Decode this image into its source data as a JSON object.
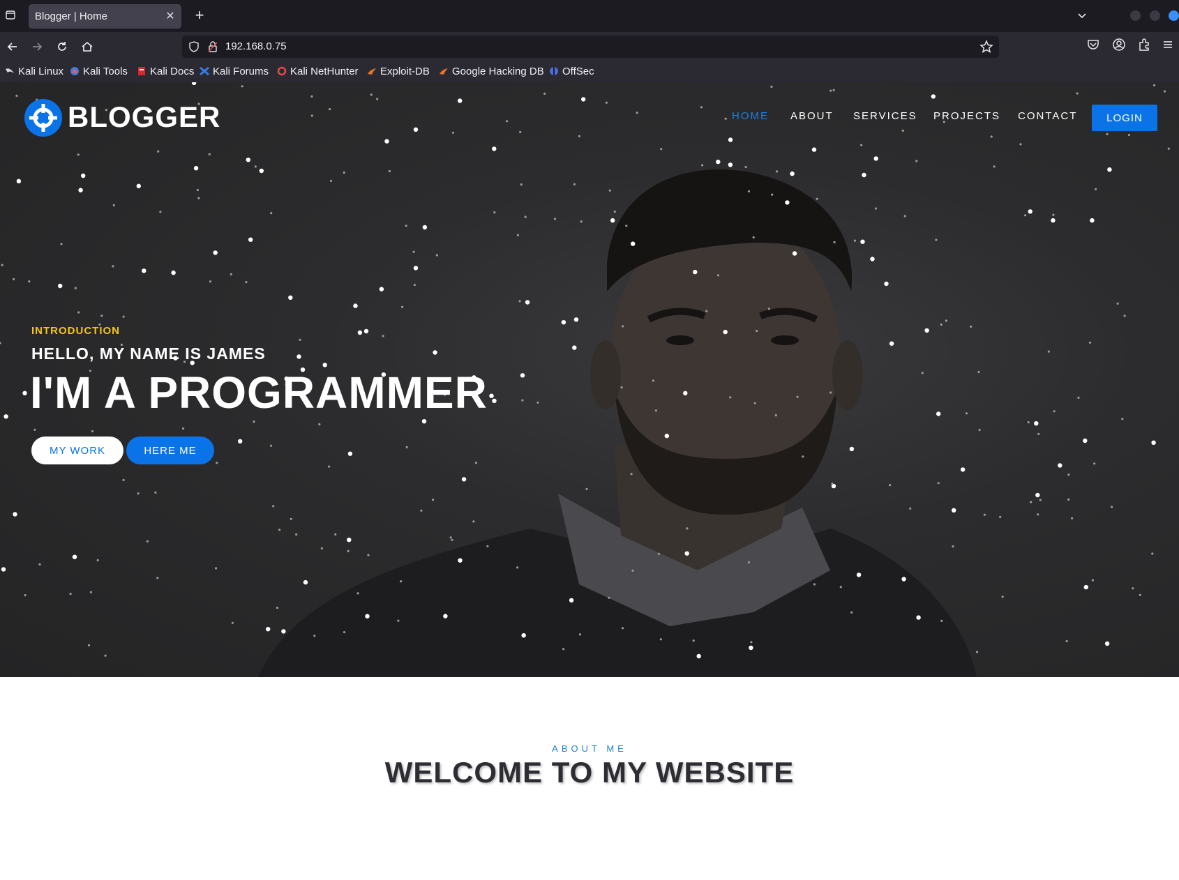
{
  "browser": {
    "tab": {
      "title": "Blogger | Home"
    },
    "url": "192.168.0.75",
    "bookmarks": [
      {
        "label": "Kali Linux",
        "icon": "kali-dragon-icon"
      },
      {
        "label": "Kali Tools",
        "icon": "kali-tools-icon"
      },
      {
        "label": "Kali Docs",
        "icon": "kali-docs-icon"
      },
      {
        "label": "Kali Forums",
        "icon": "kali-forums-icon"
      },
      {
        "label": "Kali NetHunter",
        "icon": "nethunter-icon"
      },
      {
        "label": "Exploit-DB",
        "icon": "exploit-db-icon"
      },
      {
        "label": "Google Hacking DB",
        "icon": "ghdb-icon"
      },
      {
        "label": "OffSec",
        "icon": "offsec-icon"
      }
    ]
  },
  "site": {
    "brand": "BLOGGER",
    "menu": [
      {
        "label": "HOME",
        "active": true
      },
      {
        "label": "ABOUT",
        "active": false
      },
      {
        "label": "SERVICES",
        "active": false
      },
      {
        "label": "PROJECTS",
        "active": false
      },
      {
        "label": "CONTACT",
        "active": false
      }
    ],
    "login_label": "LOGIN",
    "hero": {
      "kicker": "INTRODUCTION",
      "greeting": "HELLO, MY NAME IS JAMES",
      "headline": "I'M A PROGRAMMER",
      "btn_work": "MY WORK",
      "btn_here": "HERE ME"
    },
    "about": {
      "label": "ABOUT ME",
      "title": "WELCOME TO MY WEBSITE"
    }
  },
  "colors": {
    "accent": "#0a73e8",
    "active_menu": "#1e7fe0",
    "kicker": "#f5c518",
    "hero_bg": "#2c2c2e"
  }
}
